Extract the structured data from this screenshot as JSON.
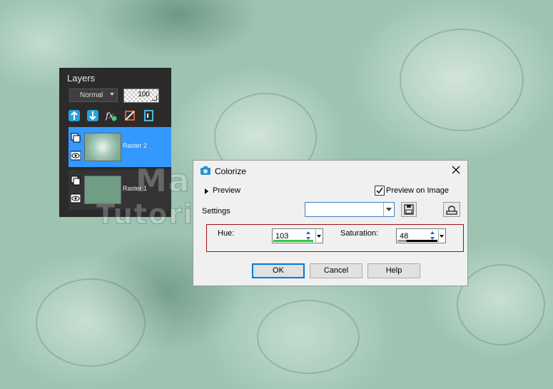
{
  "layers_panel": {
    "title": "Layers",
    "blend_mode": "Normal",
    "opacity": "100",
    "toolbar_icons": [
      "add-raster-layer-icon",
      "add-vector-layer-icon",
      "layer-effects-icon",
      "mask-icon",
      "group-icon"
    ],
    "layers": [
      {
        "name": "Raster 2",
        "selected": true
      },
      {
        "name": "Raster 1",
        "selected": false
      }
    ]
  },
  "watermark": {
    "line1": "Maisy",
    "line2": "Tutorials"
  },
  "dialog": {
    "title": "Colorize",
    "preview_label": "Preview",
    "preview_on_image_label": "Preview on Image",
    "preview_on_image_checked": true,
    "settings_label": "Settings",
    "preset_value": "",
    "hue_label": "Hue:",
    "hue_value": "103",
    "saturation_label": "Saturation:",
    "saturation_value": "48",
    "ok_label": "OK",
    "cancel_label": "Cancel",
    "help_label": "Help"
  },
  "colors": {
    "panel_bg": "#2b2b2b",
    "selection": "#3399ff",
    "hue_bar": "#2ecc40",
    "highlight_box": "#a01010",
    "default_button_border": "#0078d7"
  }
}
